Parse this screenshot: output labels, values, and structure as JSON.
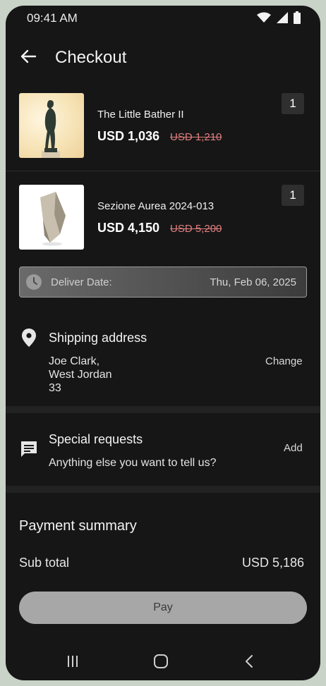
{
  "status_bar": {
    "time": "09:41 AM"
  },
  "header": {
    "title": "Checkout"
  },
  "items": [
    {
      "name": "The Little Bather II",
      "price": "USD 1,036",
      "old_price": "USD 1,210",
      "qty": "1"
    },
    {
      "name": "Sezione Aurea 2024-013",
      "price": "USD 4,150",
      "old_price": "USD 5,200",
      "qty": "1"
    }
  ],
  "deliver": {
    "label": "Deliver Date:",
    "value": "Thu, Feb 06, 2025"
  },
  "shipping": {
    "title": "Shipping address",
    "name": "Joe Clark,",
    "city": "West Jordan",
    "number": "33",
    "action": "Change"
  },
  "requests": {
    "title": "Special requests",
    "subtitle": "Anything else you want to tell us?",
    "action": "Add"
  },
  "payment": {
    "title": "Payment summary",
    "subtotal_label": "Sub total",
    "subtotal_value": "USD 5,186",
    "pay_label": "Pay"
  },
  "colors": {
    "background": "#161616",
    "old_price": "#e07e7e",
    "pay_button": "#a7a7a7"
  }
}
